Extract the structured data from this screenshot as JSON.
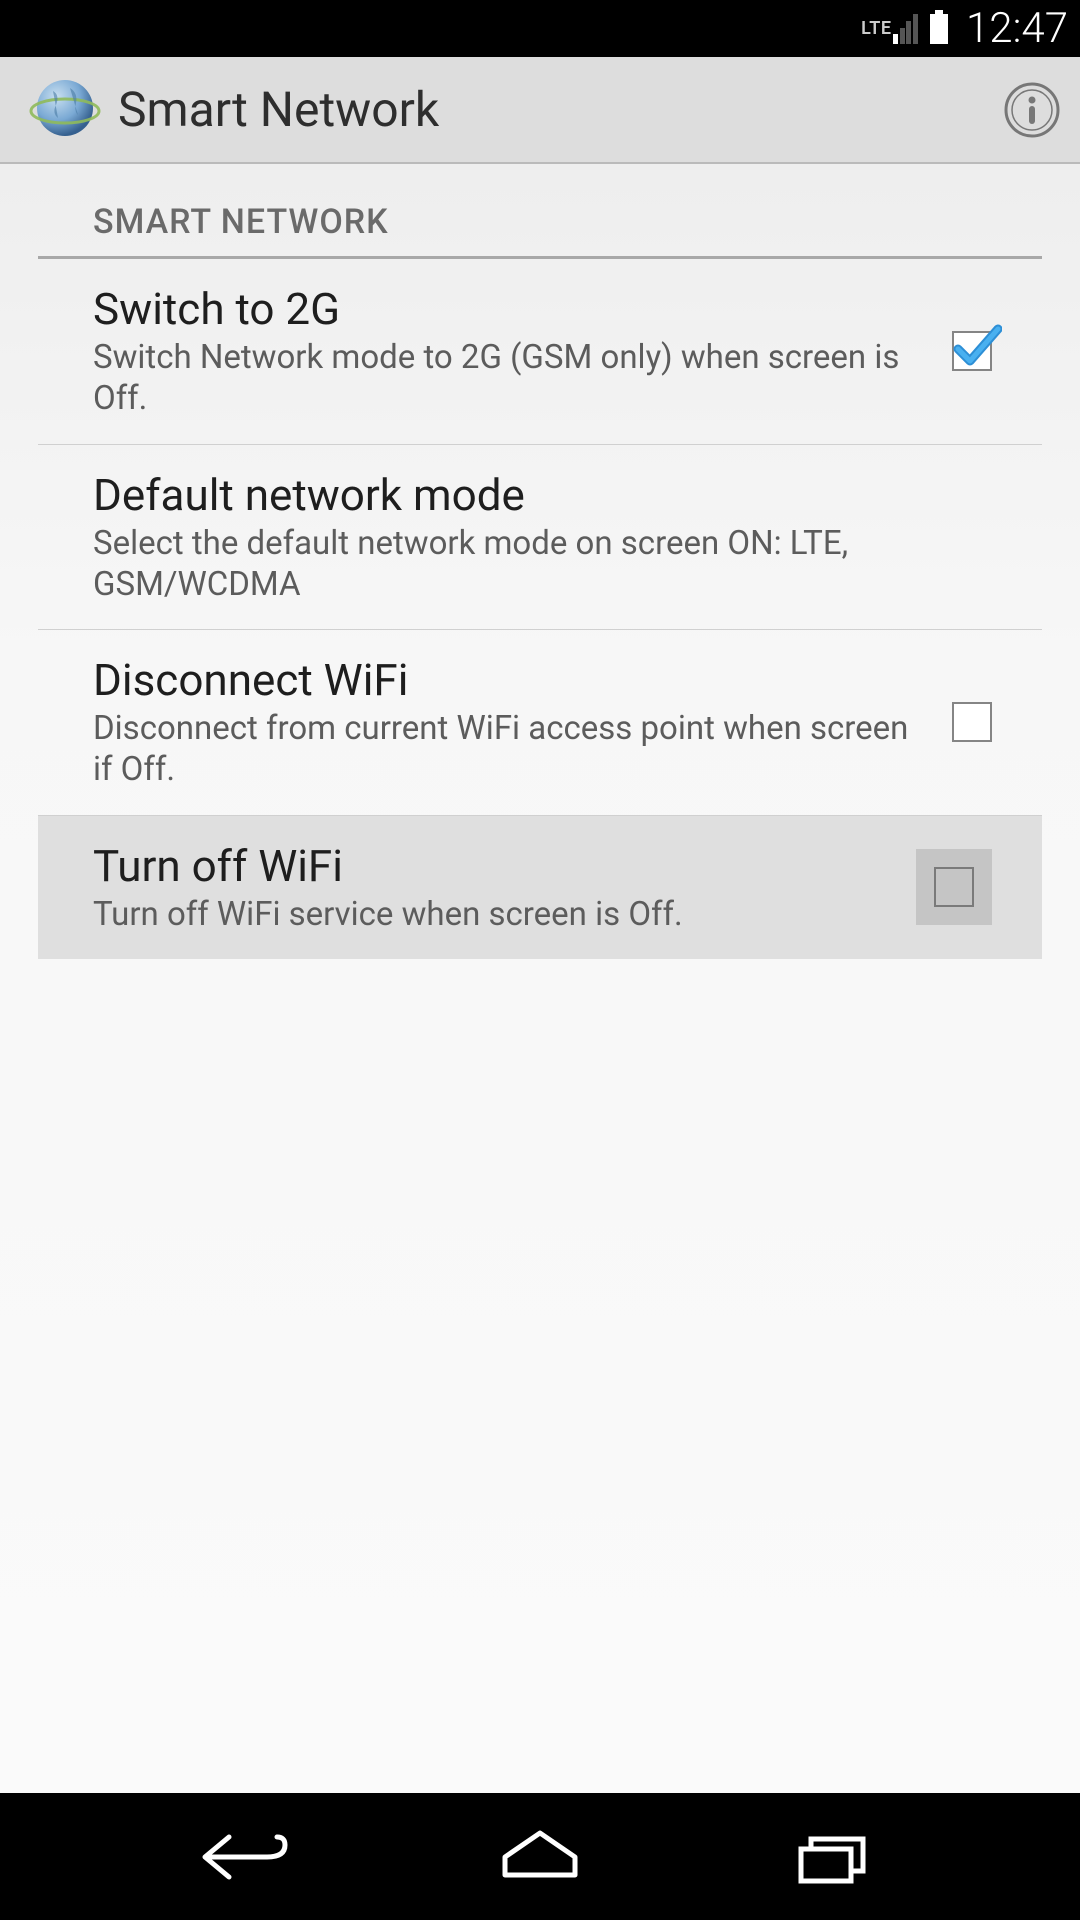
{
  "status": {
    "network_label": "LTE",
    "time": "12:47"
  },
  "appbar": {
    "title": "Smart Network"
  },
  "section": {
    "header": "SMART NETWORK"
  },
  "items": [
    {
      "title": "Switch to 2G",
      "subtitle": "Switch Network mode to 2G (GSM only) when screen is Off.",
      "checked": true,
      "enabled": true,
      "has_checkbox": true
    },
    {
      "title": "Default network mode",
      "subtitle": "Select the default network mode on screen ON: LTE, GSM/WCDMA",
      "has_checkbox": false,
      "enabled": true
    },
    {
      "title": "Disconnect WiFi",
      "subtitle": "Disconnect from current WiFi access point when screen if Off.",
      "checked": false,
      "enabled": true,
      "has_checkbox": true
    },
    {
      "title": "Turn off WiFi",
      "subtitle": "Turn off WiFi service when screen is Off.",
      "checked": false,
      "enabled": false,
      "has_checkbox": true
    }
  ]
}
